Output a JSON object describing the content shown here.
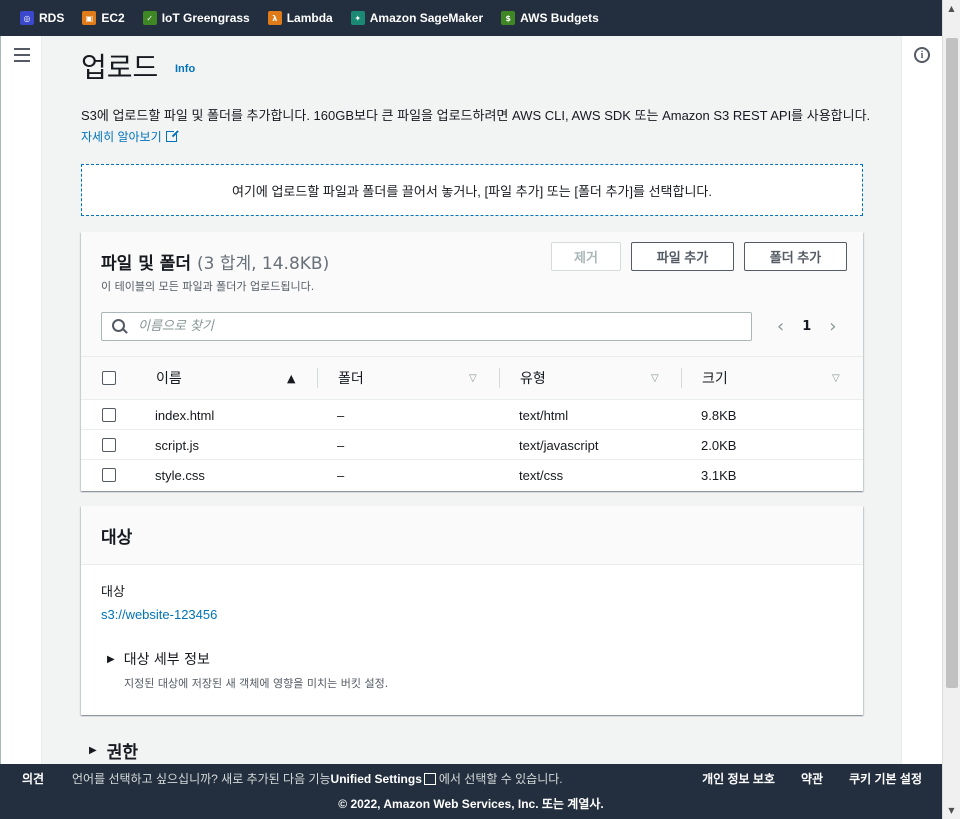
{
  "topbar": {
    "services": [
      {
        "label": "RDS",
        "icon": "rds-icon",
        "color": "#3b48cc"
      },
      {
        "label": "EC2",
        "icon": "ec2-icon",
        "color": "#e07b1a"
      },
      {
        "label": "IoT Greengrass",
        "icon": "iot-greengrass-icon",
        "color": "#3f8624"
      },
      {
        "label": "Lambda",
        "icon": "lambda-icon",
        "color": "#e07b1a"
      },
      {
        "label": "Amazon SageMaker",
        "icon": "sagemaker-icon",
        "color": "#1b8a74"
      },
      {
        "label": "AWS Budgets",
        "icon": "budgets-icon",
        "color": "#3f8624"
      }
    ]
  },
  "page": {
    "title": "업로드",
    "info_link": "Info",
    "description": "S3에 업로드할 파일 및 폴더를 추가합니다. 160GB보다 큰 파일을 업로드하려면 AWS CLI, AWS SDK 또는 Amazon S3 REST API를 사용합니다.",
    "learn_more": "자세히 알아보기",
    "dropzone_text": "여기에 업로드할 파일과 폴더를 끌어서 놓거나, [파일 추가] 또는 [폴더 추가]를 선택합니다."
  },
  "files": {
    "title": "파일 및 폴더",
    "count": "(3 합계, 14.8KB)",
    "subtitle": "이 테이블의 모든 파일과 폴더가 업로드됩니다.",
    "remove_button": "제거",
    "add_file_button": "파일 추가",
    "add_folder_button": "폴더 추가",
    "search_placeholder": "이름으로 찾기",
    "current_page": "1",
    "columns": [
      "이름",
      "폴더",
      "유형",
      "크기"
    ],
    "rows": [
      {
        "name": "index.html",
        "folder": "–",
        "type": "text/html",
        "size": "9.8KB"
      },
      {
        "name": "script.js",
        "folder": "–",
        "type": "text/javascript",
        "size": "2.0KB"
      },
      {
        "name": "style.css",
        "folder": "–",
        "type": "text/css",
        "size": "3.1KB"
      }
    ]
  },
  "destination": {
    "title": "대상",
    "label": "대상",
    "bucket": "s3://website-123456",
    "details_title": "대상 세부 정보",
    "details_desc": "지정된 대상에 저장된 새 객체에 영향을 미치는 버킷 설정."
  },
  "permissions": {
    "title": "권한"
  },
  "footer": {
    "feedback": "의견",
    "lang_prefix": "언어를 선택하고 싶으십니까? 새로 추가된 다음 기능",
    "lang_link": "Unified Settings",
    "lang_suffix": "에서 선택할 수 있습니다.",
    "privacy": "개인 정보 보호",
    "terms": "약관",
    "cookies": "쿠키 기본 설정",
    "copyright": "© 2022, Amazon Web Services, Inc. 또는 계열사."
  }
}
